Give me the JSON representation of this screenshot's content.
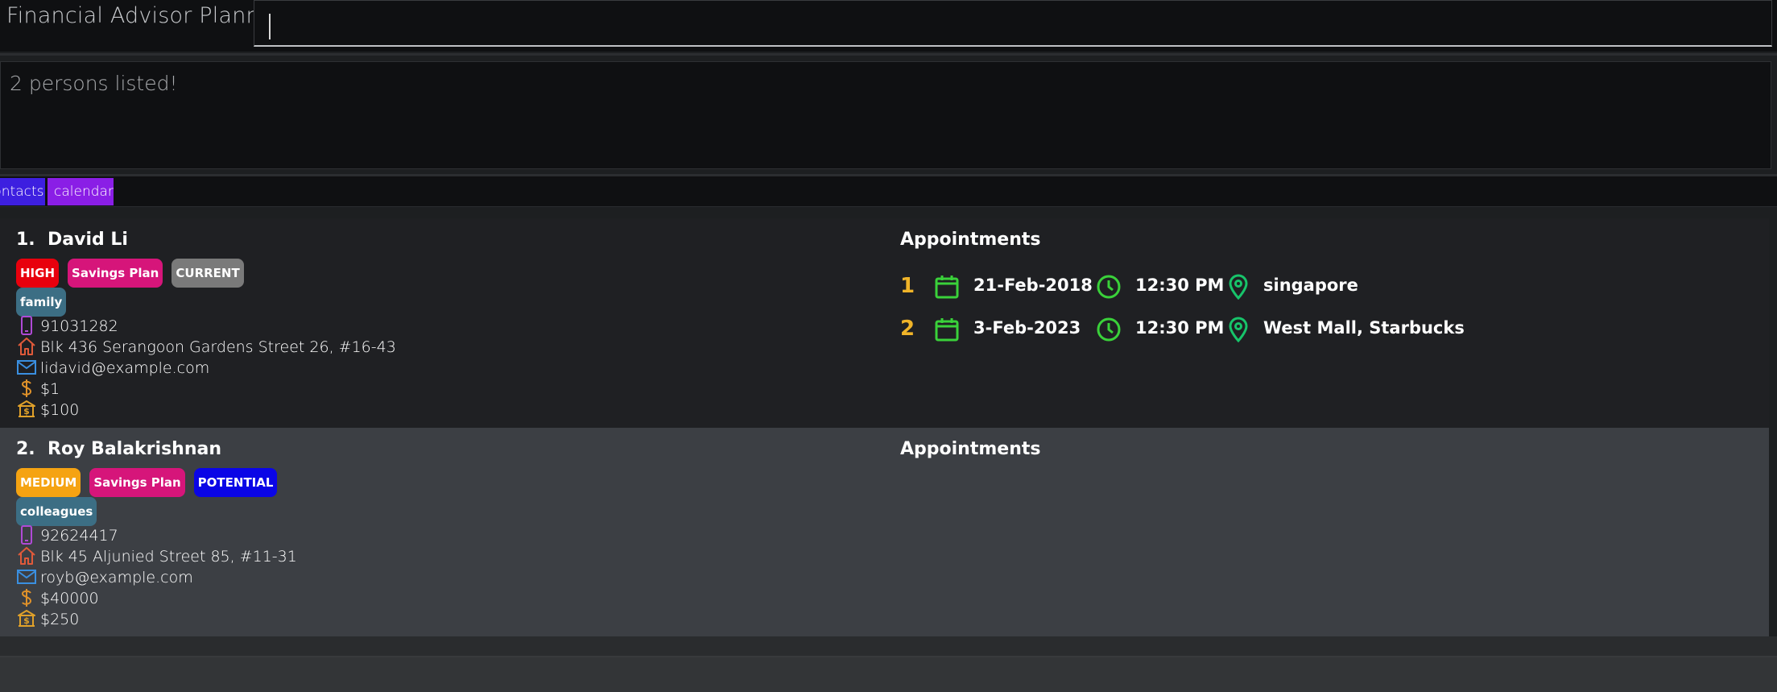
{
  "app": {
    "title": "Financial Advisor Planner"
  },
  "command": {
    "value": "",
    "placeholder": ""
  },
  "result": {
    "message": "2 persons listed!"
  },
  "tabs": [
    {
      "label": "contacts",
      "color": "#3d1fe0"
    },
    {
      "label": "calendar",
      "color": "#8a1ee6"
    }
  ],
  "persons": [
    {
      "index": "1.",
      "name": "David Li",
      "tags": [
        {
          "label": "HIGH",
          "color": "#e8000d"
        },
        {
          "label": "Savings Plan",
          "color": "#d6157a"
        },
        {
          "label": "CURRENT",
          "color": "#7a7a7a"
        }
      ],
      "groups": [
        {
          "label": "family",
          "color": "#3c6e84"
        }
      ],
      "phone": "91031282",
      "address": "Blk 436 Serangoon Gardens Street 26, #16-43",
      "email": "lidavid@example.com",
      "income": "$1",
      "monthly": "$100",
      "appointments_title": "Appointments",
      "appointments": [
        {
          "index": "1",
          "date": "21-Feb-2018",
          "time": "12:30 PM",
          "location": "singapore"
        },
        {
          "index": "2",
          "date": "3-Feb-2023",
          "time": "12:30 PM",
          "location": "West Mall, Starbucks"
        }
      ]
    },
    {
      "index": "2.",
      "name": "Roy Balakrishnan",
      "tags": [
        {
          "label": "MEDIUM",
          "color": "#f5a312"
        },
        {
          "label": "Savings Plan",
          "color": "#d6157a"
        },
        {
          "label": "POTENTIAL",
          "color": "#0a05e6"
        }
      ],
      "groups": [
        {
          "label": "colleagues",
          "color": "#3c6e84"
        }
      ],
      "phone": "92624417",
      "address": "Blk 45 Aljunied Street 85, #11-31",
      "email": "royb@example.com",
      "income": "$40000",
      "monthly": "$250",
      "appointments_title": "Appointments",
      "appointments": []
    }
  ],
  "icons": {
    "phone": "phone-icon",
    "address": "home-icon",
    "email": "mail-icon",
    "income": "dollar-icon",
    "monthly": "bank-icon",
    "date": "calendar-icon",
    "time": "clock-icon",
    "location": "map-pin-icon"
  },
  "colors": {
    "phone_icon": "#b04ad6",
    "home_icon": "#e05a3a",
    "mail_icon": "#3a8fe0",
    "dollar_icon": "#e0922a",
    "bank_icon": "#e0a12a",
    "appt_green": "#3ad13a",
    "pin_green": "#17c46a",
    "appt_index": "#f0b429"
  }
}
